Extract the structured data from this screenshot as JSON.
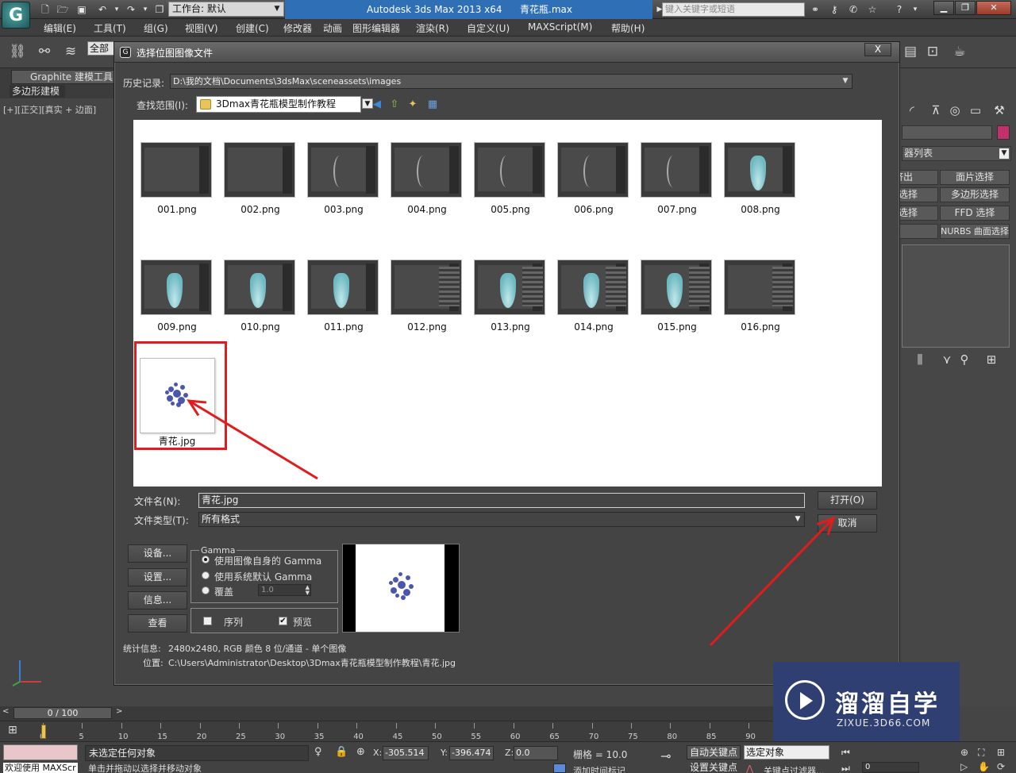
{
  "app": {
    "workspace_label": "工作台: 默认",
    "title_app": "Autodesk 3ds Max  2013 x64",
    "title_file": "青花瓶.max",
    "search_placeholder": "键入关键字或短语"
  },
  "menubar": [
    "编辑(E)",
    "工具(T)",
    "组(G)",
    "视图(V)",
    "创建(C)",
    "修改器",
    "动画",
    "图形编辑器",
    "渲染(R)",
    "自定义(U)",
    "MAXScript(M)",
    "帮助(H)"
  ],
  "toolbar": {
    "selection_filter": "全部"
  },
  "ribbon": {
    "graphite_tab": "Graphite 建模工具",
    "poly_tab": "多边形建模"
  },
  "viewport": {
    "label": "[+][正交][真实 + 边面]"
  },
  "right_panel": {
    "modifier_list": "器列表",
    "buttons": [
      "挤出",
      "面片选择",
      "线选择",
      "多边形选择",
      "仅选择",
      "FFD 选择",
      "",
      "NURBS 曲面选择"
    ]
  },
  "dialog": {
    "title": "选择位图图像文件",
    "close_label": "X",
    "history_label": "历史记录:",
    "history_value": "D:\\我的文档\\Documents\\3dsMax\\sceneassets\\images",
    "lookin_label": "查找范围(I):",
    "lookin_value": "3Dmax青花瓶模型制作教程",
    "files": [
      {
        "name": "001.png",
        "kind": "dark"
      },
      {
        "name": "002.png",
        "kind": "dark"
      },
      {
        "name": "003.png",
        "kind": "curve"
      },
      {
        "name": "004.png",
        "kind": "curve"
      },
      {
        "name": "005.png",
        "kind": "curve"
      },
      {
        "name": "006.png",
        "kind": "curve"
      },
      {
        "name": "007.png",
        "kind": "curve"
      },
      {
        "name": "008.png",
        "kind": "vase"
      },
      {
        "name": "009.png",
        "kind": "vase"
      },
      {
        "name": "010.png",
        "kind": "vase"
      },
      {
        "name": "011.png",
        "kind": "vase"
      },
      {
        "name": "012.png",
        "kind": "panel"
      },
      {
        "name": "013.png",
        "kind": "vase-panel"
      },
      {
        "name": "014.png",
        "kind": "vase-panel"
      },
      {
        "name": "015.png",
        "kind": "vase-panel"
      },
      {
        "name": "016.png",
        "kind": "panel"
      },
      {
        "name": "青花.jpg",
        "kind": "pattern"
      }
    ],
    "filename_label": "文件名(N):",
    "filename_value": "青花.jpg",
    "filetype_label": "文件类型(T):",
    "filetype_value": "所有格式",
    "open_button": "打开(O)",
    "cancel_button": "取消",
    "setup_button_1": "设备...",
    "setup_button_2": "设置...",
    "info_button": "信息...",
    "view_button": "查看",
    "gamma_title": "Gamma",
    "gamma_options": [
      "使用图像自身的 Gamma",
      "使用系统默认 Gamma",
      "覆盖"
    ],
    "gamma_override_value": "1.0",
    "sequence_label": "序列",
    "preview_label": "预览",
    "preview_checked": true,
    "stats_label": "统计信息:",
    "stats_value": "2480x2480, RGB 颜色 8 位/通道 - 单个图像",
    "location_label": "位置:",
    "location_value": "C:\\Users\\Administrator\\Desktop\\3Dmax青花瓶模型制作教程\\青花.jpg"
  },
  "timeline": {
    "frame": "0 / 100",
    "ticks": [
      "0",
      "5",
      "10",
      "15",
      "20",
      "25",
      "30",
      "35",
      "40",
      "45",
      "50",
      "55",
      "60",
      "65",
      "70",
      "75",
      "80",
      "85",
      "90"
    ]
  },
  "statusbar": {
    "welcome": "欢迎使用 MAXScr",
    "status": "未选定任何对象",
    "prompt": "单击并拖动以选择并移动对象",
    "x_label": "X:",
    "x_value": "-305.514",
    "y_label": "Y:",
    "y_value": "-396.474",
    "z_label": "Z:",
    "z_value": "0.0",
    "grid": "栅格 = 10.0",
    "auto_key": "自动关键点",
    "set_key": "设置关键点",
    "selected": "选定对象",
    "add_time_tag": "添加时间标记",
    "key_filters": "关键点过滤器...",
    "frame_value": "0"
  },
  "watermark": {
    "cn": "溜溜自学",
    "en": "ZIXUE.3D66.COM"
  },
  "annotation_color": "#e01c1c"
}
